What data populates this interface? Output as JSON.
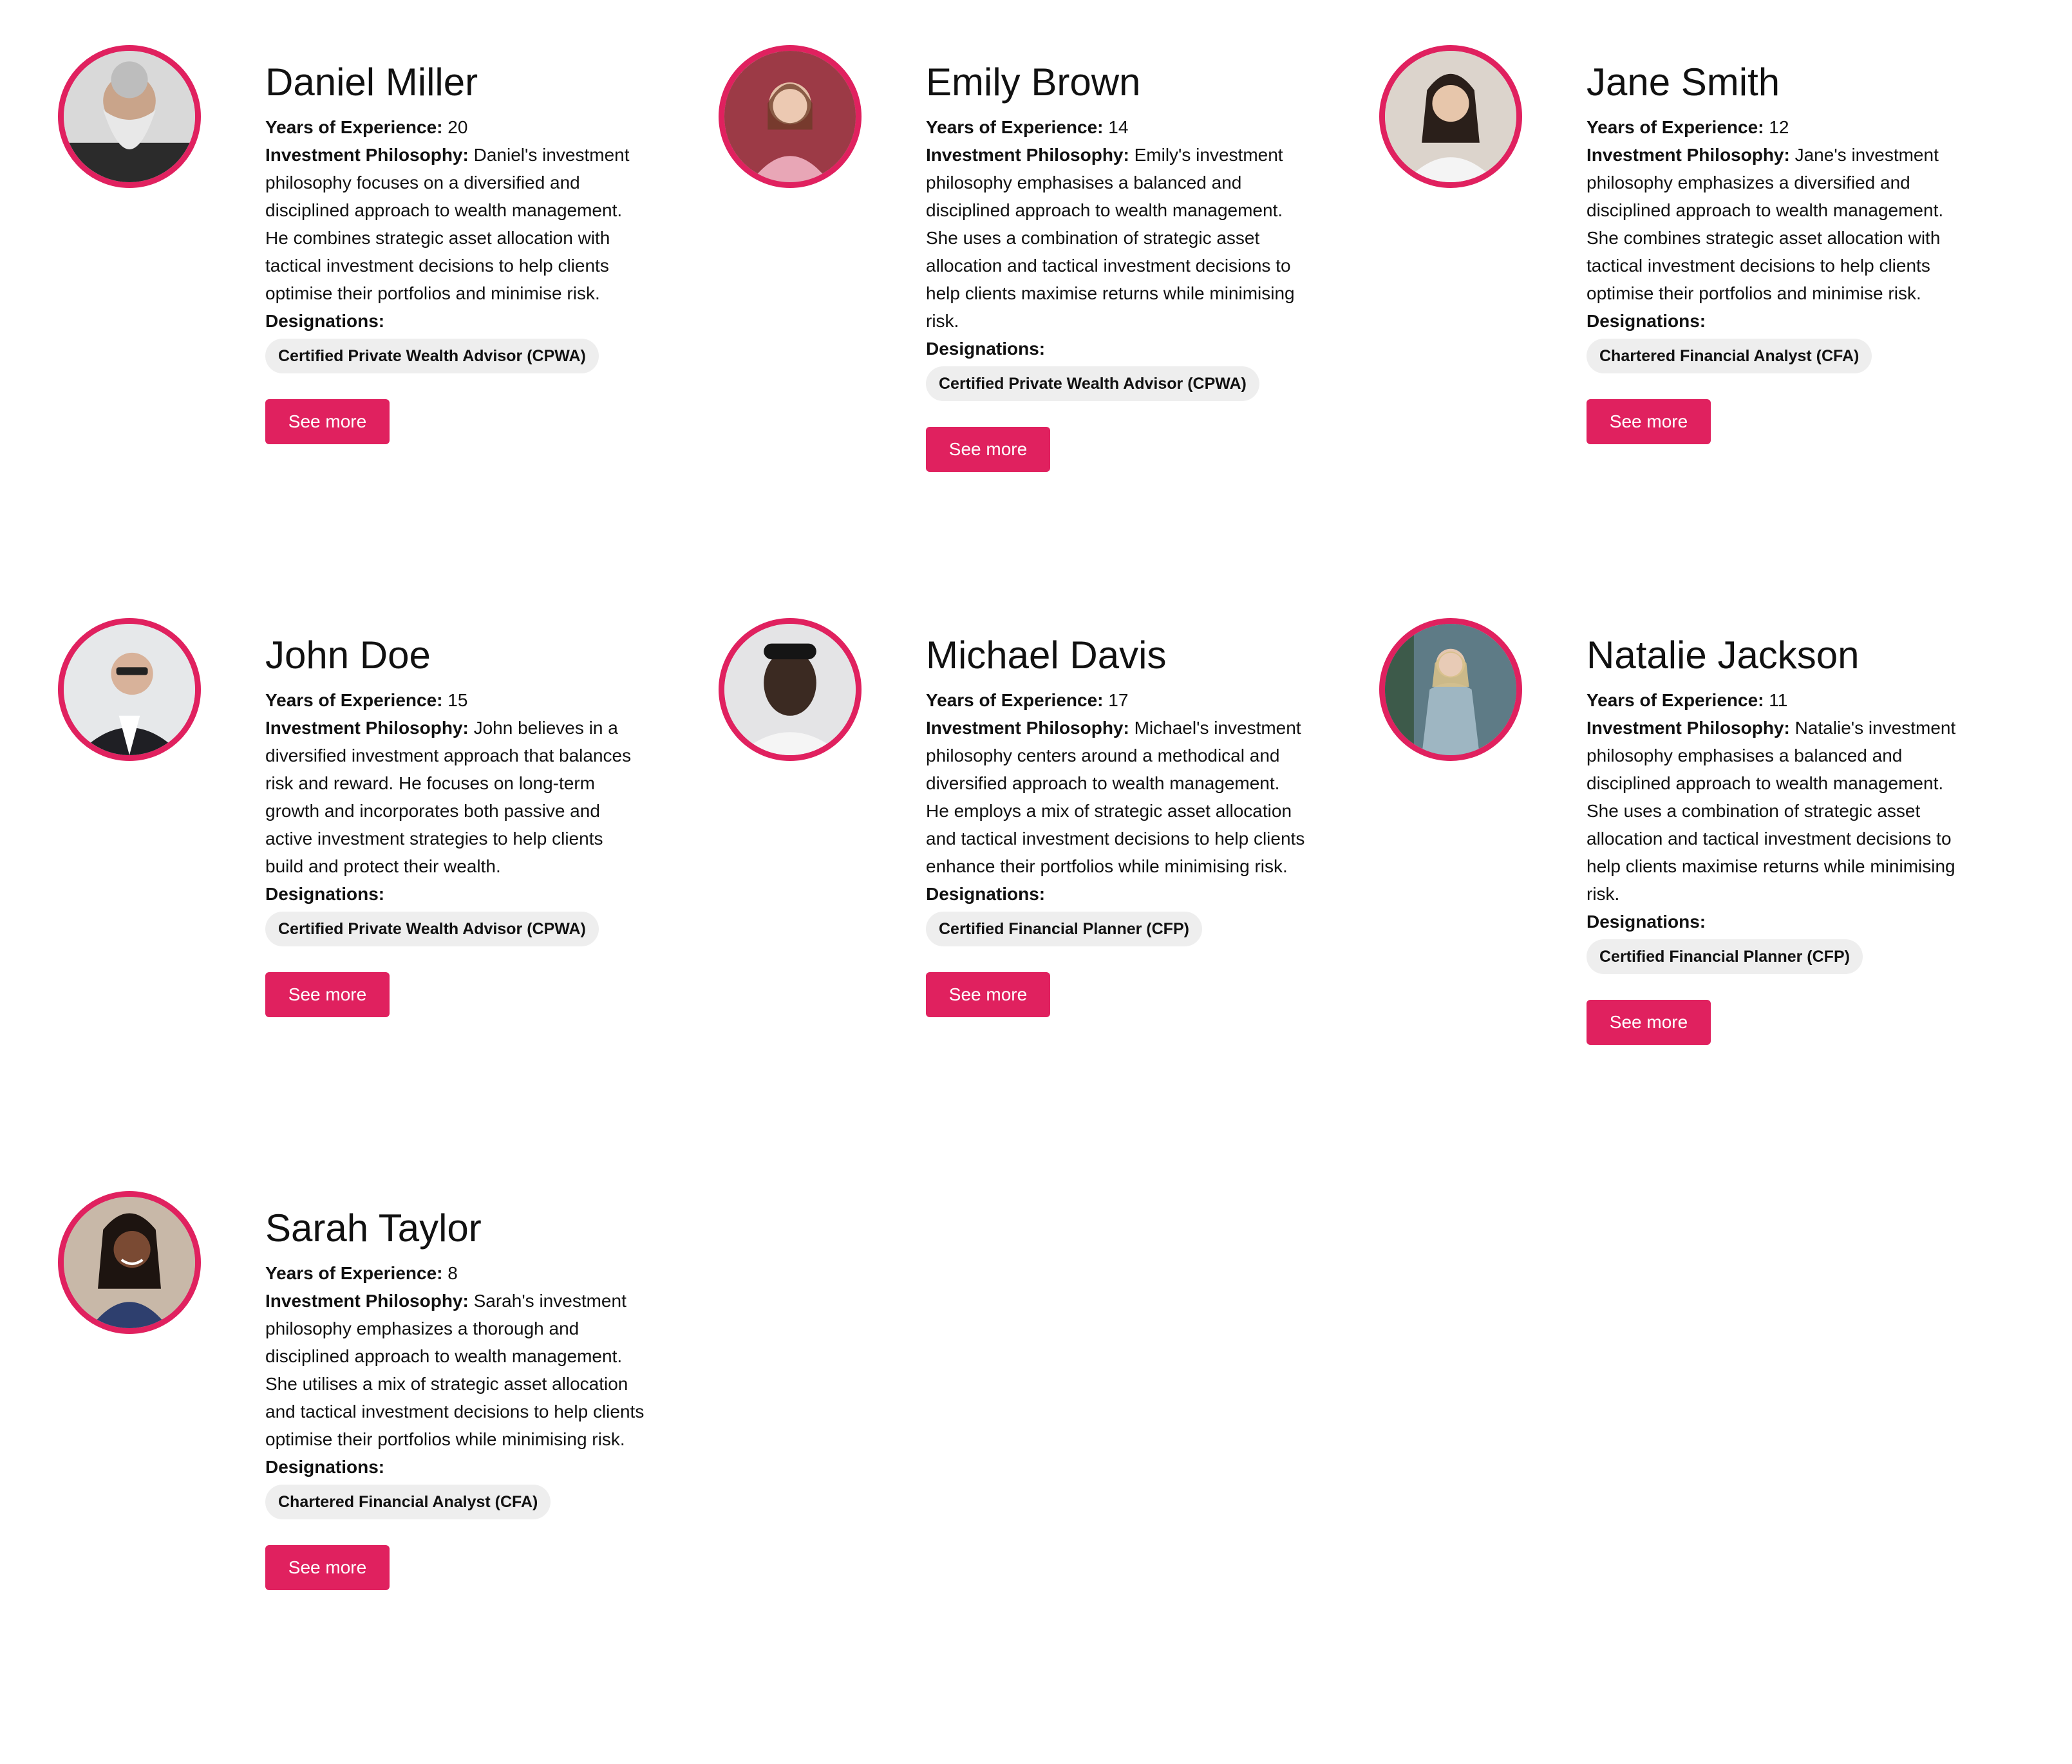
{
  "labels": {
    "experience": "Years of Experience:",
    "philosophy": "Investment Philosophy:",
    "designations": "Designations:",
    "see_more": "See more"
  },
  "colors": {
    "accent": "#e0215f",
    "chip_bg": "#eeeeee"
  },
  "advisors": [
    {
      "name": "Daniel Miller",
      "years": "20",
      "philosophy": "Daniel's investment philosophy focuses on a diversified and disciplined approach to wealth management. He combines strategic asset allocation with tactical investment decisions to help clients optimise their portfolios and minimise risk.",
      "designation": "Certified Private Wealth Advisor (CPWA)"
    },
    {
      "name": "Emily Brown",
      "years": "14",
      "philosophy": "Emily's investment philosophy emphasises a balanced and disciplined approach to wealth management. She uses a combination of strategic asset allocation and tactical investment decisions to help clients maximise returns while minimising risk.",
      "designation": "Certified Private Wealth Advisor (CPWA)"
    },
    {
      "name": "Jane Smith",
      "years": "12",
      "philosophy": "Jane's investment philosophy emphasizes a diversified and disciplined approach to wealth management. She combines strategic asset allocation with tactical investment decisions to help clients optimise their portfolios and minimise risk.",
      "designation": "Chartered Financial Analyst (CFA)"
    },
    {
      "name": "John Doe",
      "years": "15",
      "philosophy": "John believes in a diversified investment approach that balances risk and reward. He focuses on long-term growth and incorporates both passive and active investment strategies to help clients build and protect their wealth.",
      "designation": "Certified Private Wealth Advisor (CPWA)"
    },
    {
      "name": "Michael Davis",
      "years": "17",
      "philosophy": "Michael's investment philosophy centers around a methodical and diversified approach to wealth management. He employs a mix of strategic asset allocation and tactical investment decisions to help clients enhance their portfolios while minimising risk.",
      "designation": "Certified Financial Planner (CFP)"
    },
    {
      "name": "Natalie Jackson",
      "years": "11",
      "philosophy": "Natalie's investment philosophy emphasises a balanced and disciplined approach to wealth management. She uses a combination of strategic asset allocation and tactical investment decisions to help clients maximise returns while minimising risk.",
      "designation": "Certified Financial Planner (CFP)"
    },
    {
      "name": "Sarah Taylor",
      "years": "8",
      "philosophy": "Sarah's investment philosophy emphasizes a thorough and disciplined approach to wealth management. She utilises a mix of strategic asset allocation and tactical investment decisions to help clients optimise their portfolios while minimising risk.",
      "designation": "Chartered Financial Analyst (CFA)"
    }
  ]
}
